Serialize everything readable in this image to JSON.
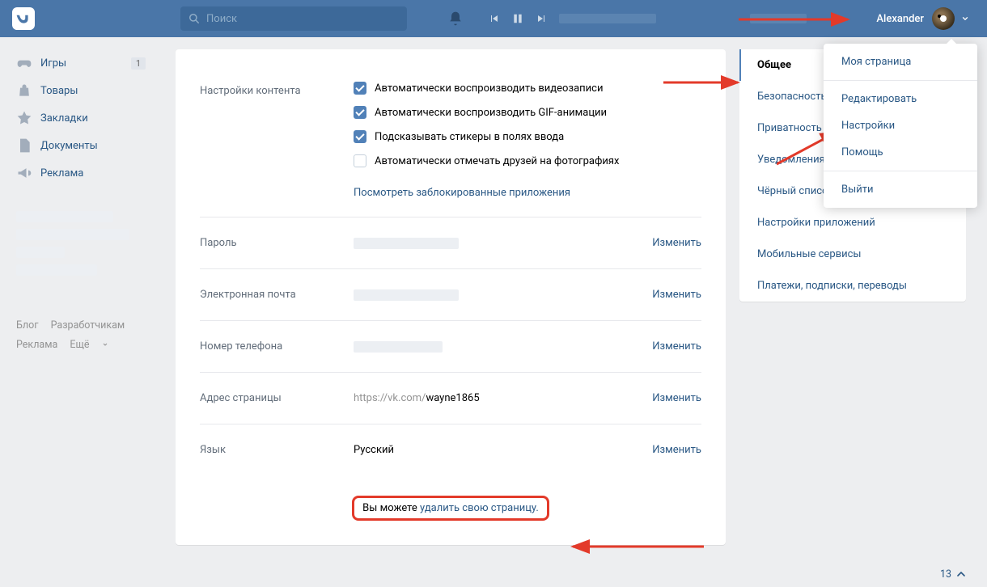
{
  "header": {
    "search_placeholder": "Поиск",
    "user_name": "Alexander"
  },
  "nav": {
    "items": [
      {
        "label": "Игры",
        "badge": "1"
      },
      {
        "label": "Товары"
      },
      {
        "label": "Закладки"
      },
      {
        "label": "Документы"
      },
      {
        "label": "Реклама"
      }
    ]
  },
  "footer": {
    "links": [
      "Блог",
      "Разработчикам",
      "Реклама",
      "Ещё"
    ]
  },
  "settings": {
    "content_label": "Настройки контента",
    "checks": [
      "Автоматически воспроизводить видеозаписи",
      "Автоматически воспроизводить GIF-анимации",
      "Подсказывать стикеры в полях ввода",
      "Автоматически отмечать друзей на фотографиях"
    ],
    "blocked_link": "Посмотреть заблокированные приложения",
    "password_label": "Пароль",
    "email_label": "Электронная почта",
    "phone_label": "Номер телефона",
    "address_label": "Адрес страницы",
    "address_value": "https://vk.com/wayne1865",
    "language_label": "Язык",
    "language_value": "Русский",
    "edit": "Изменить",
    "delete_prefix": "Вы можете ",
    "delete_link": "удалить свою страницу."
  },
  "tabs": [
    "Общее",
    "Безопасность",
    "Приватность",
    "Уведомления",
    "Чёрный список",
    "Настройки приложений",
    "Мобильные сервисы",
    "Платежи, подписки, переводы"
  ],
  "dropdown": [
    "Моя страница",
    "Редактировать",
    "Настройки",
    "Помощь",
    "Выйти"
  ],
  "notif_count": "13"
}
